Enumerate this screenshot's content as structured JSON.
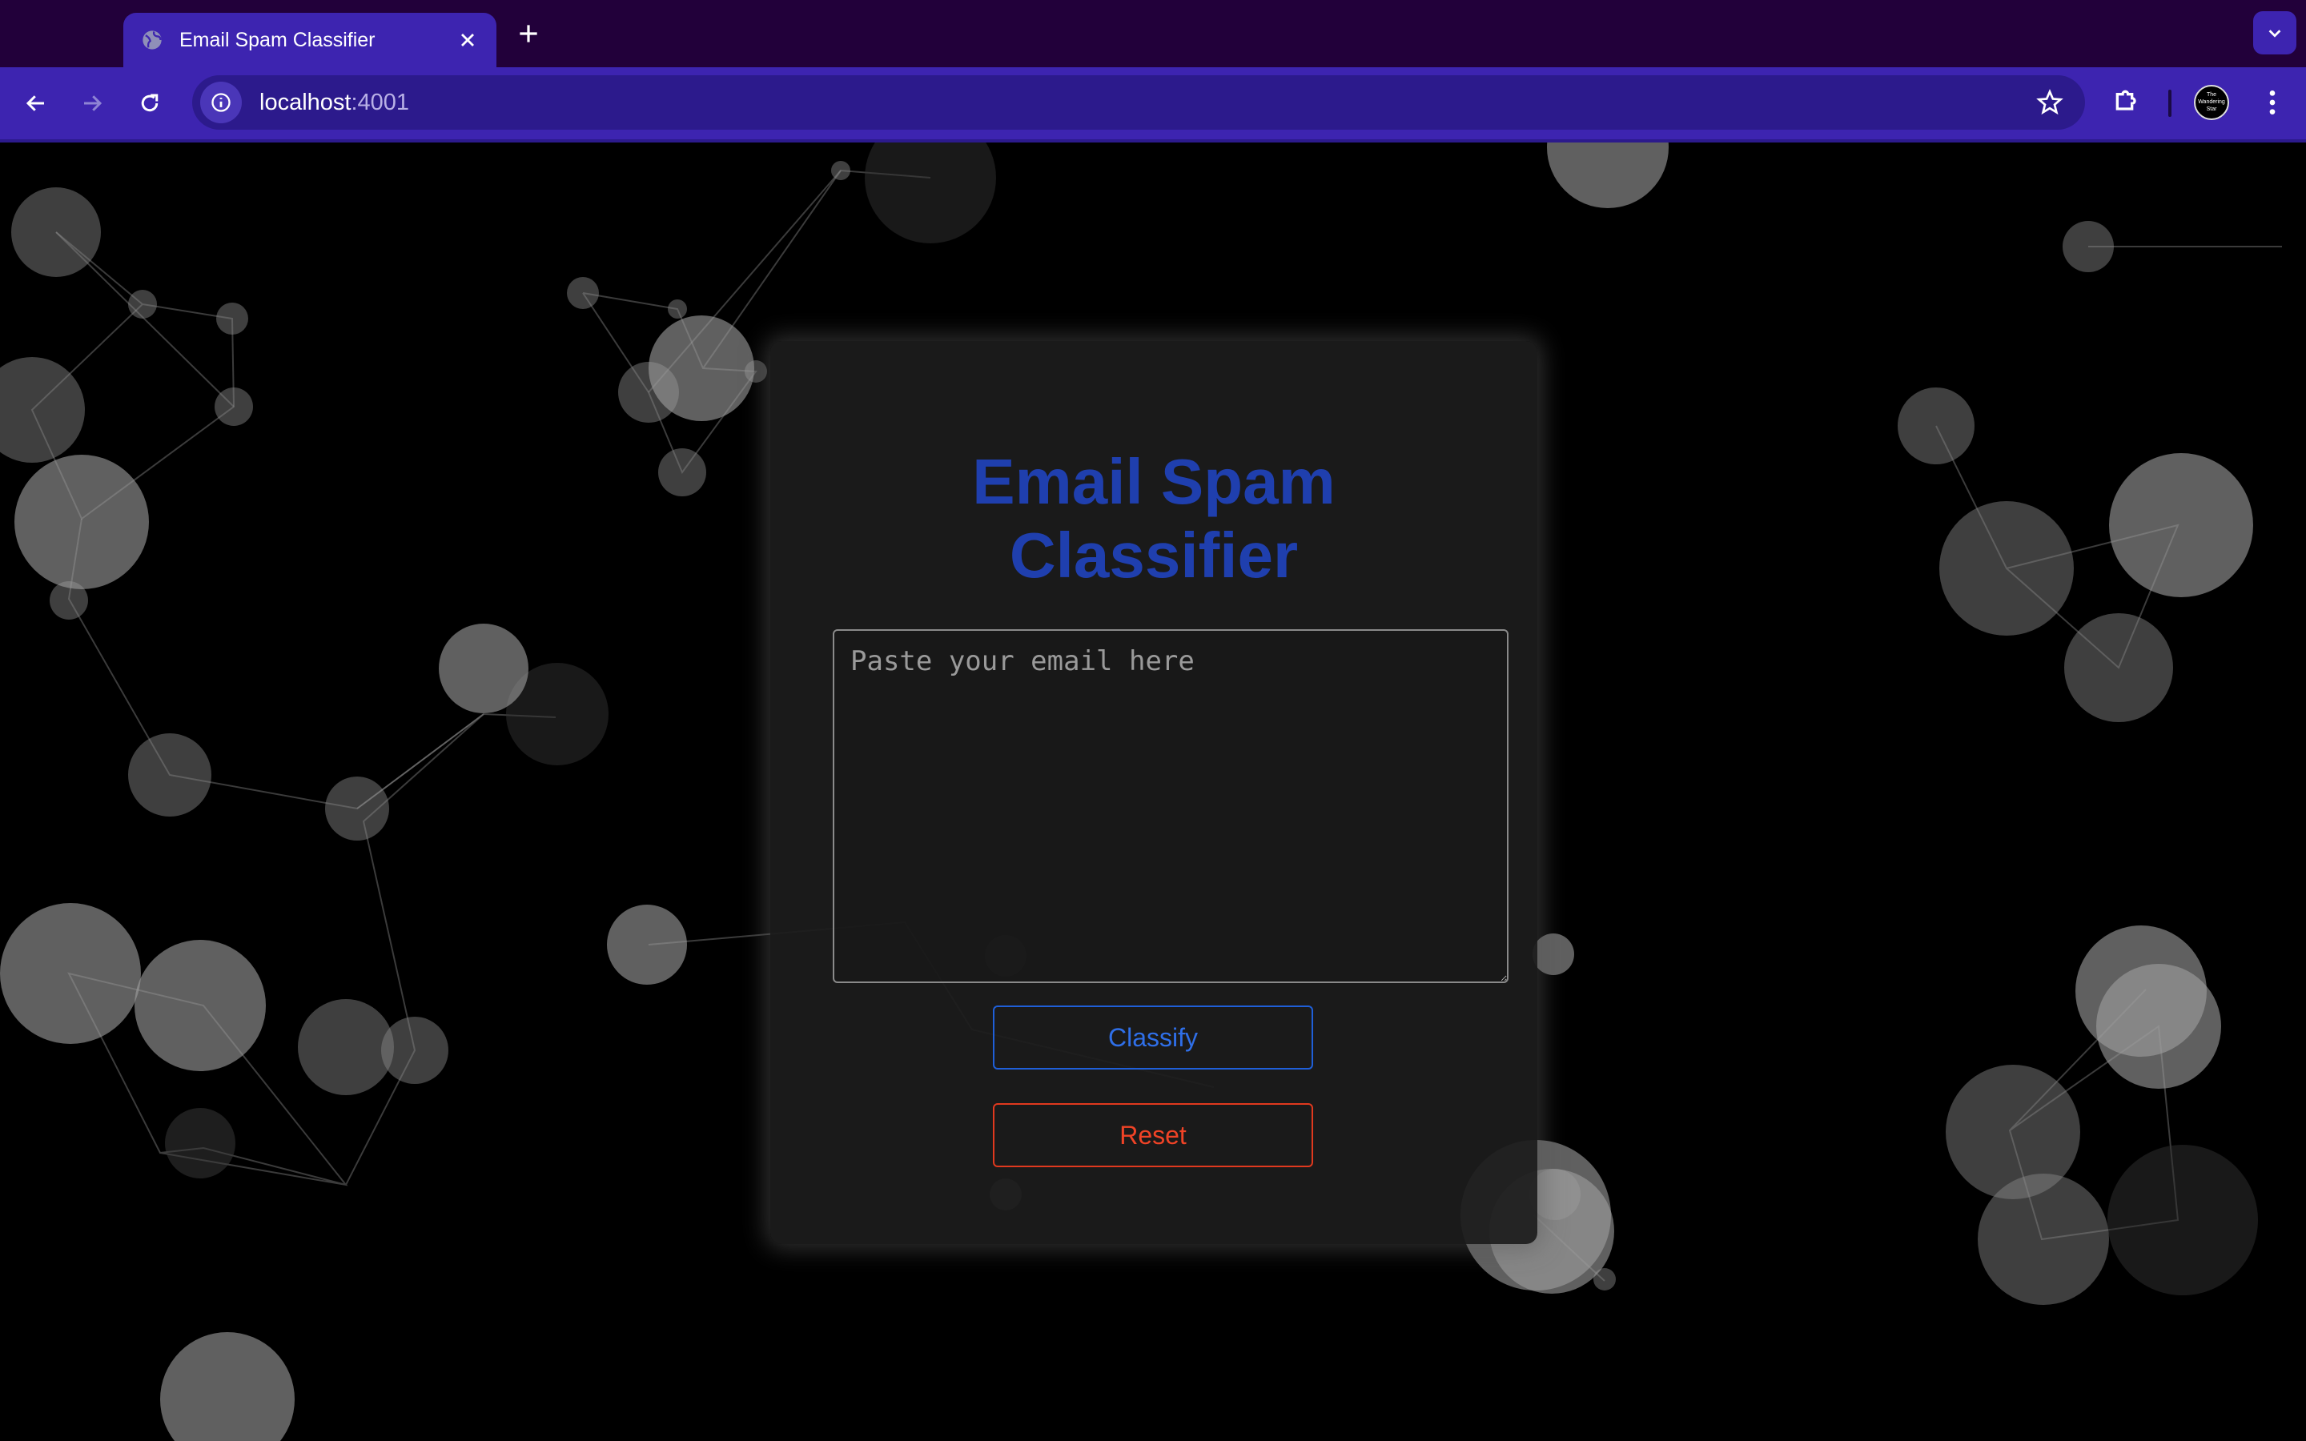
{
  "browser": {
    "tab_title": "Email Spam Classifier",
    "url_host": "localhost",
    "url_port": ":4001",
    "profile_label": "The Wandering Star",
    "icons": [
      "globe-icon",
      "close-icon",
      "plus-icon",
      "chevron-down-icon",
      "back-arrow-icon",
      "forward-arrow-icon",
      "reload-icon",
      "info-icon",
      "star-icon",
      "puzzle-icon",
      "kebab-menu-icon"
    ]
  },
  "app": {
    "title_line1": "Email Spam",
    "title_line2": "Classifier",
    "input_placeholder": "Paste your email here",
    "input_value": "",
    "classify_label": "Classify",
    "reset_label": "Reset"
  },
  "colors": {
    "title": "#1f3fae",
    "classify": "#1f5fd8",
    "reset": "#e0391e",
    "chrome": "#3d24b0",
    "tabstrip": "#22003a"
  }
}
